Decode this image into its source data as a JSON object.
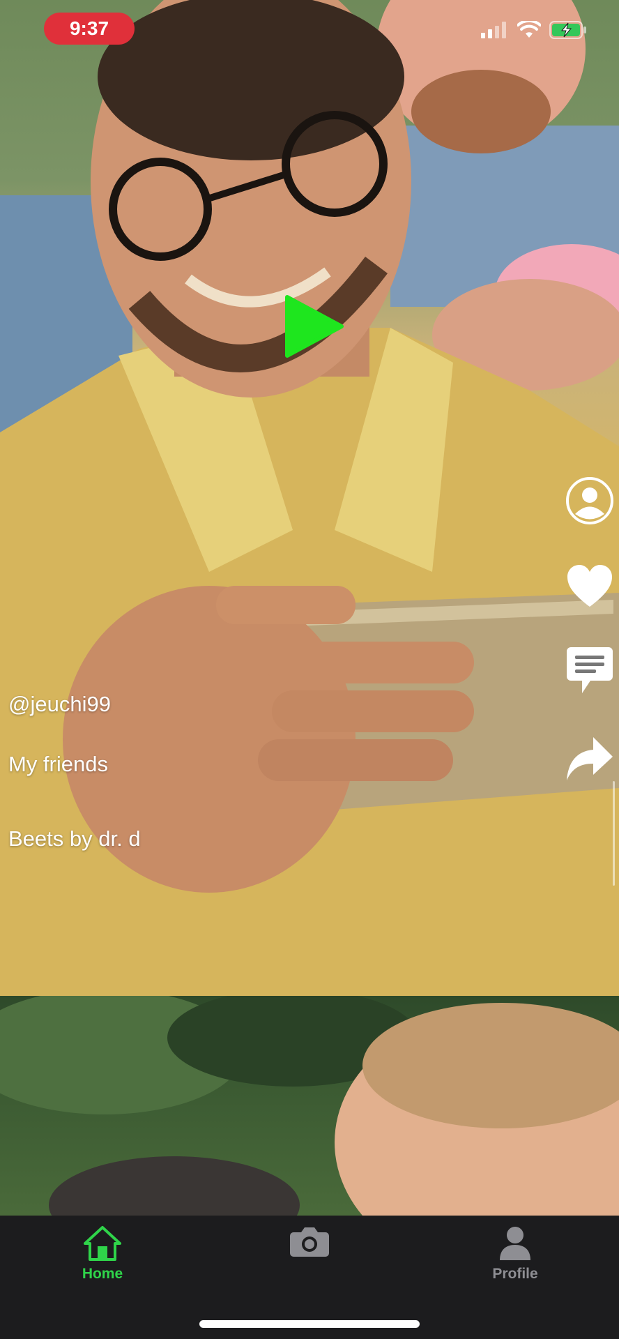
{
  "status_bar": {
    "time": "9:37",
    "icons": [
      "cellular-signal-icon",
      "wifi-icon",
      "battery-charging-icon"
    ]
  },
  "post": {
    "username": "@jeuchi99",
    "caption": "My friends",
    "music": "Beets by dr. d"
  },
  "actions": [
    "profile-icon",
    "heart-icon",
    "comment-icon",
    "share-icon"
  ],
  "tabs": [
    {
      "label": "Home",
      "icon": "home-icon",
      "active": true
    },
    {
      "label": "",
      "icon": "camera-icon",
      "active": false
    },
    {
      "label": "Profile",
      "icon": "person-icon",
      "active": false
    }
  ],
  "colors": {
    "accent": "#2fd44a",
    "play": "#1ee61e",
    "time_pill": "#e0303a",
    "tab_bar": "#1c1c1e",
    "inactive_tab": "#8e8e93"
  }
}
